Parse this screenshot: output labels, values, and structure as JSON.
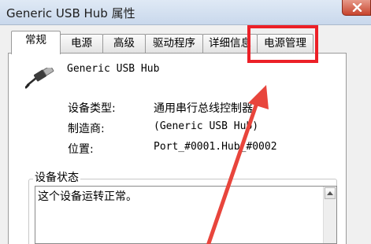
{
  "window": {
    "title": "Generic USB Hub 属性",
    "close_icon": "close-icon"
  },
  "tabs": [
    {
      "label": "常规",
      "selected": true
    },
    {
      "label": "电源",
      "selected": false
    },
    {
      "label": "高级",
      "selected": false
    },
    {
      "label": "驱动程序",
      "selected": false
    },
    {
      "label": "详细信息",
      "selected": false
    },
    {
      "label": "电源管理",
      "selected": false
    }
  ],
  "device": {
    "icon": "usb-device-icon",
    "name": "Generic USB Hub",
    "properties": [
      {
        "label": "设备类型:",
        "value": "通用串行总线控制器"
      },
      {
        "label": "制造商:",
        "value": "(Generic USB Hub)"
      },
      {
        "label": "位置:",
        "value": "Port_#0001.Hub_#0002"
      }
    ]
  },
  "status": {
    "legend": "设备状态",
    "text": "这个设备运转正常。"
  },
  "annotation": {
    "highlight_color": "#ec2027",
    "arrow_color": "#e8453c"
  }
}
